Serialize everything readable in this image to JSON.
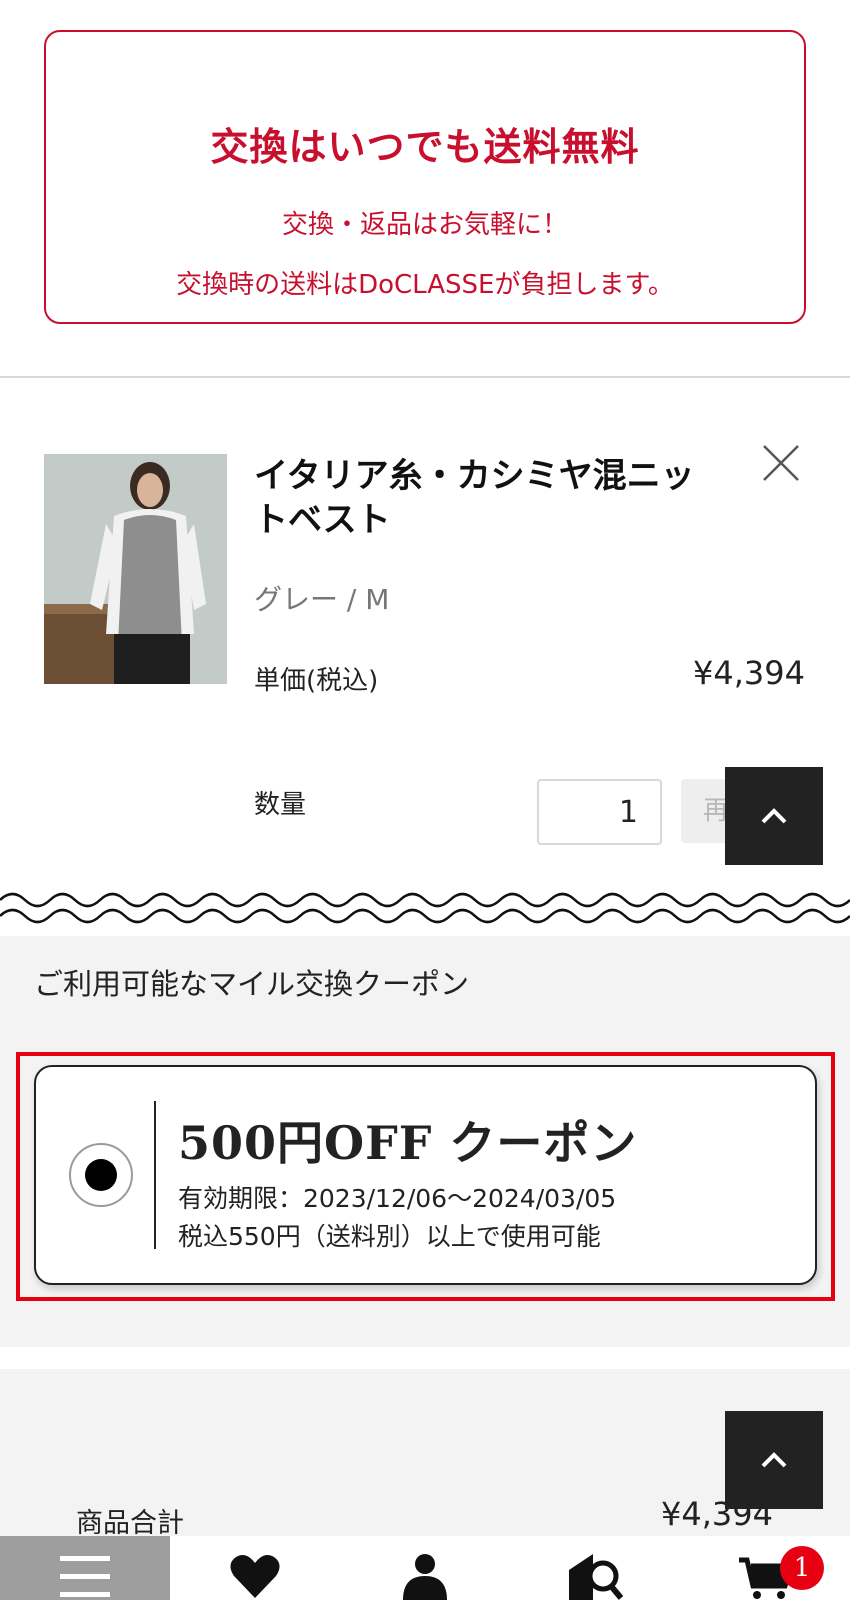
{
  "notice": {
    "title": "交換はいつでも送料無料",
    "line1": "交換・返品はお気軽に！",
    "line2": "交換時の送料はDoCLASSEが負担します。",
    "accent_color": "#c8102e"
  },
  "cart_item": {
    "name": "イタリア糸・カシミヤ混ニットベスト",
    "variant": "グレー / M",
    "price_label": "単価(税込)",
    "price": "¥4,394",
    "quantity_label": "数量",
    "quantity": "1",
    "recalc_label": "再",
    "remove_icon": "close-icon"
  },
  "coupons": {
    "heading": "ご利用可能なマイル交換クーポン",
    "items": [
      {
        "title": "500円OFF クーポン",
        "expiry": "有効期限：2023/12/06〜2024/03/05",
        "condition": "税込550円（送料別）以上で使用可能",
        "selected": true
      }
    ],
    "highlight_color": "#e60012"
  },
  "summary": {
    "subtotal_label": "商品合計",
    "subtotal_value": "¥4,394"
  },
  "bottom_nav": {
    "items": [
      "menu-icon",
      "heart-icon",
      "user-icon",
      "store-search-icon",
      "cart-icon"
    ],
    "cart_count": "1",
    "badge_color": "#e60012"
  }
}
